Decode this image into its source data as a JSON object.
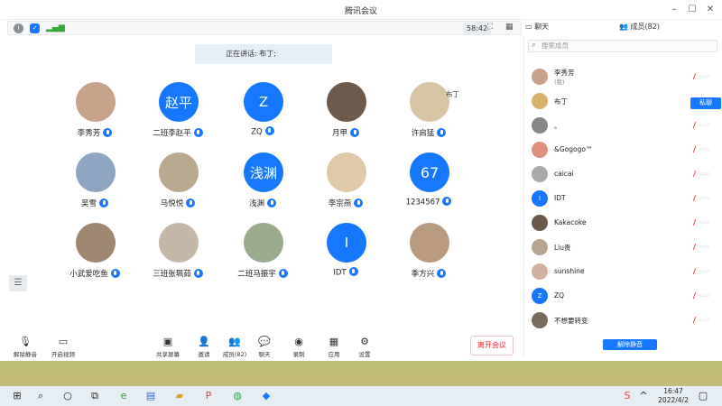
{
  "window": {
    "title": "腾讯会议"
  },
  "infobar": {
    "timer": "58:42"
  },
  "speaking": "正在讲话: 布丁;",
  "tabs": {
    "chat": "聊天",
    "members": "成员(82)"
  },
  "grid": [
    {
      "name": "李秀芳",
      "avatar_text": "",
      "kind": "photo"
    },
    {
      "name": "二班李赵平",
      "avatar_text": "赵平",
      "kind": "txt"
    },
    {
      "name": "ZQ",
      "avatar_text": "Z",
      "kind": "txt"
    },
    {
      "name": "月甲",
      "avatar_text": "",
      "kind": "photo"
    },
    {
      "name": "许启猛",
      "avatar_text": "",
      "kind": "photo",
      "note": "布丁"
    },
    {
      "name": "吴雪",
      "avatar_text": "",
      "kind": "photo"
    },
    {
      "name": "马悦悦",
      "avatar_text": "",
      "kind": "photo"
    },
    {
      "name": "浅渊",
      "avatar_text": "浅渊",
      "kind": "txt"
    },
    {
      "name": "李宗燕",
      "avatar_text": "",
      "kind": "photo"
    },
    {
      "name": "1234567",
      "avatar_text": "67",
      "kind": "num"
    },
    {
      "name": "小武爱吃鱼",
      "avatar_text": "",
      "kind": "photo"
    },
    {
      "name": "三班张珮茹",
      "avatar_text": "",
      "kind": "photo"
    },
    {
      "name": "二班马振宇",
      "avatar_text": "",
      "kind": "photo"
    },
    {
      "name": "IDT",
      "avatar_text": "I",
      "kind": "txt"
    },
    {
      "name": "季方兴",
      "avatar_text": "",
      "kind": "photo"
    }
  ],
  "panel": {
    "search_placeholder": "搜索成员",
    "private_chat": "私聊",
    "unmute_all": "解除静音",
    "members": [
      {
        "name": "李秀芳",
        "sub": "(我)",
        "avatar_text": ""
      },
      {
        "name": "布丁",
        "sub": "",
        "avatar_text": ""
      },
      {
        "name": "。",
        "sub": "",
        "avatar_text": ""
      },
      {
        "name": "&Gogogo™",
        "sub": "",
        "avatar_text": ""
      },
      {
        "name": "caicai",
        "sub": "",
        "avatar_text": ""
      },
      {
        "name": "IDT",
        "sub": "",
        "avatar_text": "I"
      },
      {
        "name": "Kakacoke",
        "sub": "",
        "avatar_text": ""
      },
      {
        "name": "Liu贵",
        "sub": "",
        "avatar_text": ""
      },
      {
        "name": "sunshine",
        "sub": "",
        "avatar_text": ""
      },
      {
        "name": "ZQ",
        "sub": "",
        "avatar_text": "Z"
      },
      {
        "name": "不想要转变",
        "sub": "",
        "avatar_text": ""
      }
    ]
  },
  "toolbar": {
    "unmute": "解除静音",
    "start_video": "开启视频",
    "share": "共享屏幕",
    "invite": "邀请",
    "members": "成员(82)",
    "chat": "聊天",
    "record": "录制",
    "apps": "应用",
    "settings": "设置",
    "leave": "离开会议"
  },
  "taskbar": {
    "time": "16:47",
    "date": "2022/4/2"
  },
  "colors": {
    "accent": "#1677ff",
    "leave": "#e22233"
  }
}
